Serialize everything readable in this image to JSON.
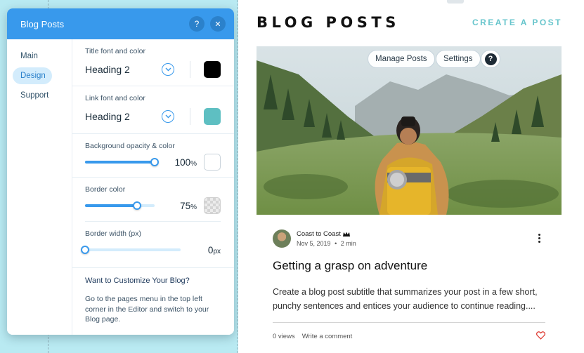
{
  "panel": {
    "title": "Blog Posts",
    "help_icon": "?",
    "close_icon": "✕",
    "nav": [
      {
        "label": "Main",
        "active": false
      },
      {
        "label": "Design",
        "active": true
      },
      {
        "label": "Support",
        "active": false
      }
    ],
    "title_font": {
      "label": "Title font and color",
      "value": "Heading 2",
      "color": "#000000"
    },
    "link_font": {
      "label": "Link font and color",
      "value": "Heading 2",
      "color": "#5ebfc2"
    },
    "background": {
      "label": "Background opacity & color",
      "value": "100",
      "unit": "%",
      "percent": 100,
      "color": "#ffffff"
    },
    "border_color": {
      "label": "Border color",
      "value": "75",
      "unit": "%",
      "percent": 75
    },
    "border_width": {
      "label": "Border width (px)",
      "value": "0",
      "unit": "px",
      "percent": 0
    },
    "promo": {
      "title": "Want to Customize Your Blog?",
      "text": "Go to the pages menu in the top left corner in the Editor and switch to your Blog page."
    }
  },
  "site": {
    "title": "BLOG POSTS",
    "create_link": "CREATE A POST",
    "manage_posts": "Manage Posts",
    "settings": "Settings",
    "help": "?",
    "post": {
      "author": "Coast to Coast",
      "date": "Nov 5, 2019",
      "read_time": "2 min",
      "date_sep": "•",
      "title": "Getting a grasp on adventure",
      "excerpt": "Create a blog post subtitle that summarizes your post in a few short, punchy sentences and entices your audience to continue reading....",
      "views": "0 views",
      "comment": "Write a comment"
    }
  },
  "colors": {
    "accent": "#3899ec",
    "link_teal": "#67c5cc",
    "heart": "#e0443c"
  }
}
